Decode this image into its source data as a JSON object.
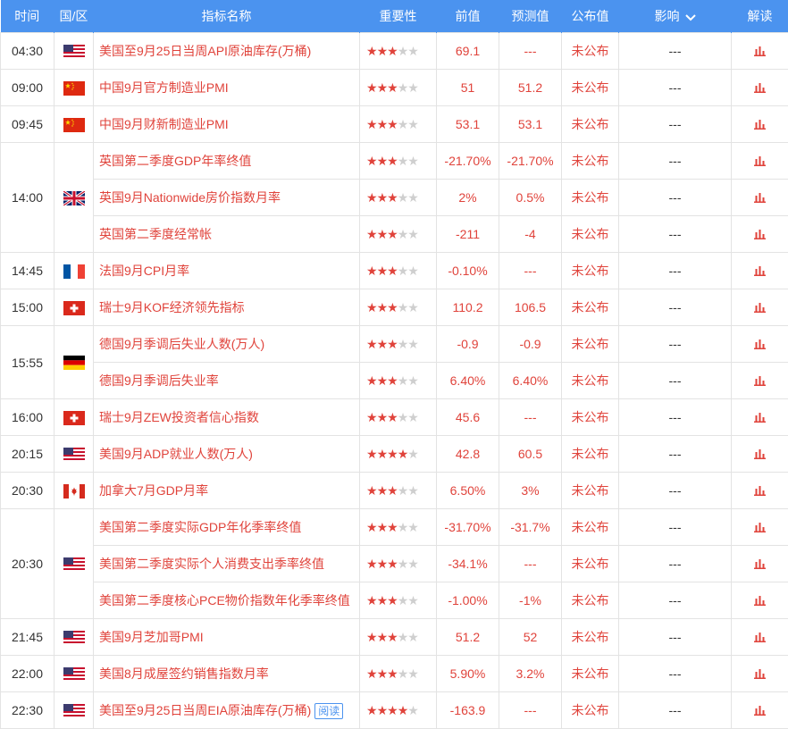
{
  "header": {
    "time": "时间",
    "region": "国/区",
    "name": "指标名称",
    "importance": "重要性",
    "previous": "前值",
    "forecast": "预测值",
    "actual": "公布值",
    "impact": "影响",
    "interpret": "解读"
  },
  "groups": [
    {
      "time": "04:30",
      "flag": "us",
      "rows": [
        {
          "name": "美国至9月25日当周API原油库存(万桶)",
          "stars": 3,
          "previous": "69.1",
          "forecast": "---",
          "actual": "未公布",
          "impact": "---"
        }
      ]
    },
    {
      "time": "09:00",
      "flag": "cn",
      "rows": [
        {
          "name": "中国9月官方制造业PMI",
          "stars": 3,
          "previous": "51",
          "forecast": "51.2",
          "actual": "未公布",
          "impact": "---"
        }
      ]
    },
    {
      "time": "09:45",
      "flag": "cn",
      "rows": [
        {
          "name": "中国9月财新制造业PMI",
          "stars": 3,
          "previous": "53.1",
          "forecast": "53.1",
          "actual": "未公布",
          "impact": "---"
        }
      ]
    },
    {
      "time": "14:00",
      "flag": "uk",
      "rows": [
        {
          "name": "英国第二季度GDP年率终值",
          "stars": 3,
          "previous": "-21.70%",
          "forecast": "-21.70%",
          "actual": "未公布",
          "impact": "---"
        },
        {
          "name": "英国9月Nationwide房价指数月率",
          "stars": 3,
          "previous": "2%",
          "forecast": "0.5%",
          "actual": "未公布",
          "impact": "---"
        },
        {
          "name": "英国第二季度经常帐",
          "stars": 3,
          "previous": "-211",
          "forecast": "-4",
          "actual": "未公布",
          "impact": "---"
        }
      ]
    },
    {
      "time": "14:45",
      "flag": "fr",
      "rows": [
        {
          "name": "法国9月CPI月率",
          "stars": 3,
          "previous": "-0.10%",
          "forecast": "---",
          "actual": "未公布",
          "impact": "---"
        }
      ]
    },
    {
      "time": "15:00",
      "flag": "ch",
      "rows": [
        {
          "name": "瑞士9月KOF经济领先指标",
          "stars": 3,
          "previous": "110.2",
          "forecast": "106.5",
          "actual": "未公布",
          "impact": "---"
        }
      ]
    },
    {
      "time": "15:55",
      "flag": "de",
      "rows": [
        {
          "name": "德国9月季调后失业人数(万人)",
          "stars": 3,
          "previous": "-0.9",
          "forecast": "-0.9",
          "actual": "未公布",
          "impact": "---"
        },
        {
          "name": "德国9月季调后失业率",
          "stars": 3,
          "previous": "6.40%",
          "forecast": "6.40%",
          "actual": "未公布",
          "impact": "---"
        }
      ]
    },
    {
      "time": "16:00",
      "flag": "ch",
      "rows": [
        {
          "name": "瑞士9月ZEW投资者信心指数",
          "stars": 3,
          "previous": "45.6",
          "forecast": "---",
          "actual": "未公布",
          "impact": "---"
        }
      ]
    },
    {
      "time": "20:15",
      "flag": "us",
      "rows": [
        {
          "name": "美国9月ADP就业人数(万人)",
          "stars": 4,
          "previous": "42.8",
          "forecast": "60.5",
          "actual": "未公布",
          "impact": "---"
        }
      ]
    },
    {
      "time": "20:30",
      "flag": "ca",
      "rows": [
        {
          "name": "加拿大7月GDP月率",
          "stars": 3,
          "previous": "6.50%",
          "forecast": "3%",
          "actual": "未公布",
          "impact": "---"
        }
      ]
    },
    {
      "time": "20:30",
      "flag": "us",
      "rows": [
        {
          "name": "美国第二季度实际GDP年化季率终值",
          "stars": 3,
          "previous": "-31.70%",
          "forecast": "-31.7%",
          "actual": "未公布",
          "impact": "---"
        },
        {
          "name": "美国第二季度实际个人消费支出季率终值",
          "stars": 3,
          "previous": "-34.1%",
          "forecast": "---",
          "actual": "未公布",
          "impact": "---"
        },
        {
          "name": "美国第二季度核心PCE物价指数年化季率终值",
          "stars": 3,
          "previous": "-1.00%",
          "forecast": "-1%",
          "actual": "未公布",
          "impact": "---"
        }
      ]
    },
    {
      "time": "21:45",
      "flag": "us",
      "rows": [
        {
          "name": "美国9月芝加哥PMI",
          "stars": 3,
          "previous": "51.2",
          "forecast": "52",
          "actual": "未公布",
          "impact": "---"
        }
      ]
    },
    {
      "time": "22:00",
      "flag": "us",
      "rows": [
        {
          "name": "美国8月成屋签约销售指数月率",
          "stars": 3,
          "previous": "5.90%",
          "forecast": "3.2%",
          "actual": "未公布",
          "impact": "---"
        }
      ]
    },
    {
      "time": "22:30",
      "flag": "us",
      "rows": [
        {
          "name": "美国至9月25日当周EIA原油库存(万桶)",
          "tag": "阅读",
          "stars": 4,
          "previous": "-163.9",
          "forecast": "---",
          "actual": "未公布",
          "impact": "---"
        }
      ]
    }
  ],
  "colors": {
    "header_bg": "#4b93ef",
    "accent_red": "#e0433b",
    "star_off": "#cfcfcf",
    "border": "#e3e3e3"
  }
}
